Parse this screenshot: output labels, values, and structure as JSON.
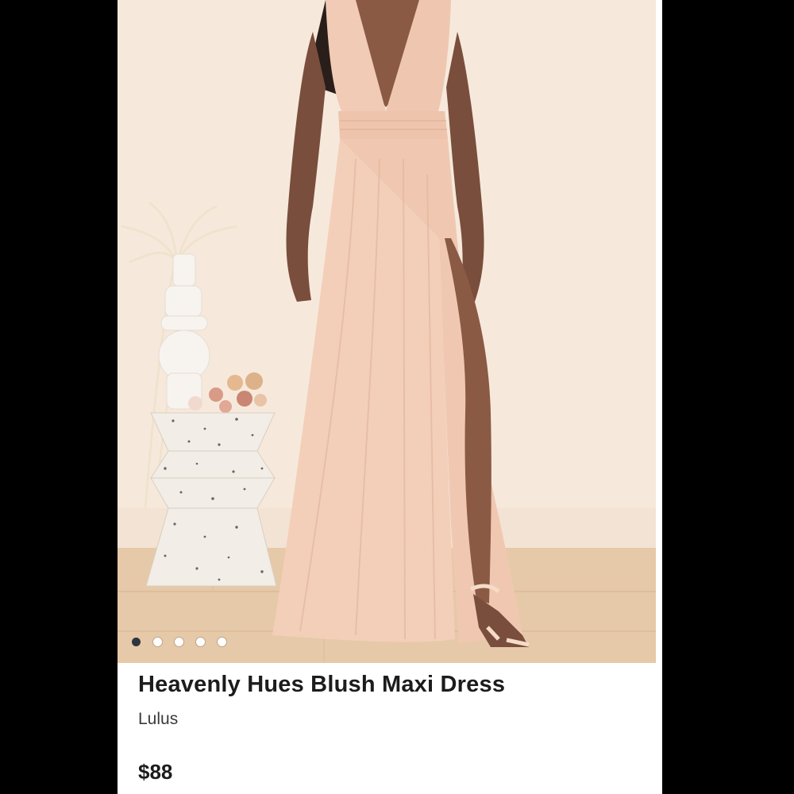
{
  "product": {
    "title": "Heavenly Hues Blush Maxi Dress",
    "brand": "Lulus",
    "price": "$88"
  },
  "carousel": {
    "image_subject": "model-in-blush-maxi-dress",
    "slide_count": 5,
    "active_index": 0
  },
  "colors": {
    "background": "#000000",
    "card": "#ffffff",
    "dress": "#f2cdb8",
    "wall": "#f6e9dc",
    "floor": "#e6c9a8",
    "active_dot": "#2f3540"
  }
}
